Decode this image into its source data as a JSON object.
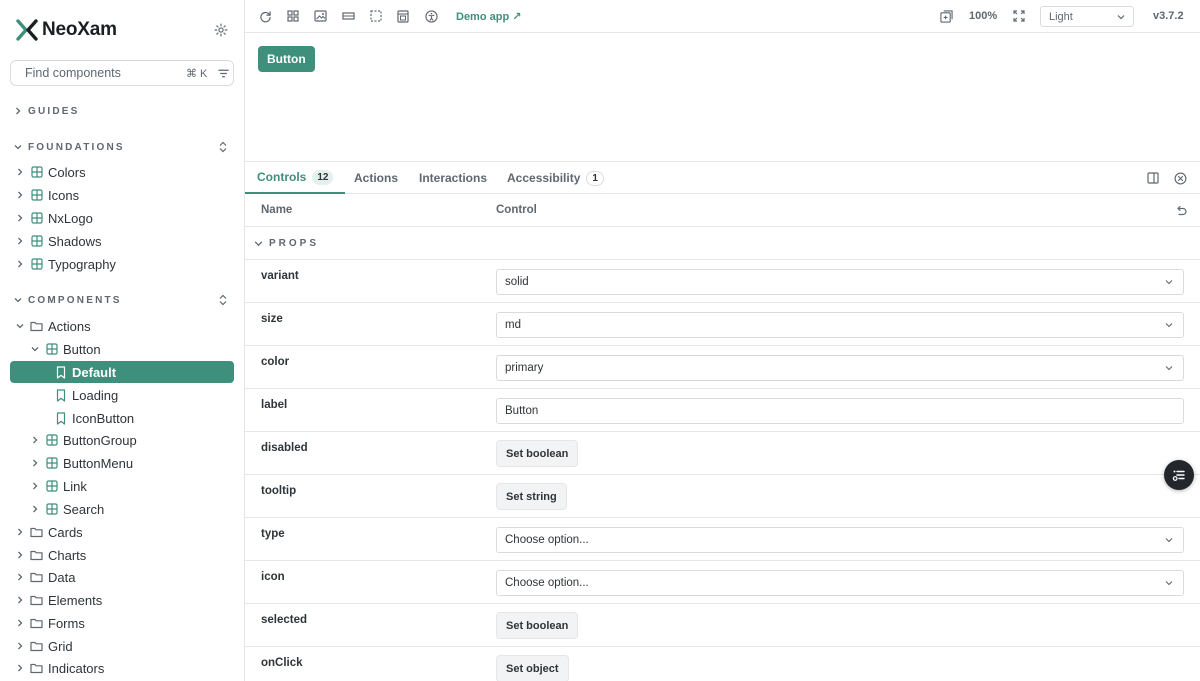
{
  "brand": {
    "name": "NeoXam"
  },
  "search": {
    "placeholder": "Find components",
    "shortcut": "⌘ K"
  },
  "sidebar": {
    "guides": {
      "label": "GUIDES"
    },
    "foundations": {
      "label": "FOUNDATIONS",
      "items": [
        {
          "label": "Colors"
        },
        {
          "label": "Icons"
        },
        {
          "label": "NxLogo"
        },
        {
          "label": "Shadows"
        },
        {
          "label": "Typography"
        }
      ]
    },
    "components": {
      "label": "COMPONENTS",
      "actions": "Actions",
      "button": "Button",
      "stories": [
        {
          "label": "Default",
          "active": true
        },
        {
          "label": "Loading"
        },
        {
          "label": "IconButton"
        }
      ],
      "action_siblings": [
        {
          "label": "ButtonGroup"
        },
        {
          "label": "ButtonMenu"
        },
        {
          "label": "Link"
        },
        {
          "label": "Search"
        }
      ],
      "folders": [
        {
          "label": "Cards"
        },
        {
          "label": "Charts"
        },
        {
          "label": "Data"
        },
        {
          "label": "Elements"
        },
        {
          "label": "Forms"
        },
        {
          "label": "Grid"
        },
        {
          "label": "Indicators"
        }
      ]
    }
  },
  "toolbar": {
    "icons": [
      "reload-icon",
      "grid-icon",
      "image-icon",
      "ruler-icon",
      "outline-icon",
      "viewport-icon",
      "accessibility-icon"
    ],
    "demo_link": "Demo app ↗",
    "zoom": "100%",
    "theme": "Light",
    "version": "v3.7.2"
  },
  "canvas": {
    "button_label": "Button"
  },
  "panel": {
    "tabs": [
      {
        "label": "Controls",
        "badge": "12",
        "active": true
      },
      {
        "label": "Actions"
      },
      {
        "label": "Interactions"
      },
      {
        "label": "Accessibility",
        "badge": "1"
      }
    ]
  },
  "controls": {
    "headers": {
      "name": "Name",
      "control": "Control"
    },
    "group": "PROPS",
    "rows": [
      {
        "name": "variant",
        "kind": "select",
        "value": "solid"
      },
      {
        "name": "size",
        "kind": "select",
        "value": "md"
      },
      {
        "name": "color",
        "kind": "select",
        "value": "primary"
      },
      {
        "name": "label",
        "kind": "text",
        "value": "Button"
      },
      {
        "name": "disabled",
        "kind": "button",
        "value": "Set boolean"
      },
      {
        "name": "tooltip",
        "kind": "button",
        "value": "Set string"
      },
      {
        "name": "type",
        "kind": "select",
        "value": "Choose option..."
      },
      {
        "name": "icon",
        "kind": "select",
        "value": "Choose option..."
      },
      {
        "name": "selected",
        "kind": "button",
        "value": "Set boolean"
      },
      {
        "name": "onClick",
        "kind": "button",
        "value": "Set object"
      }
    ]
  },
  "colors": {
    "accent": "#3e8f7c",
    "brand_dark": "#1b1f23",
    "muted": "#5f6770",
    "border": "#e6e6e6"
  }
}
